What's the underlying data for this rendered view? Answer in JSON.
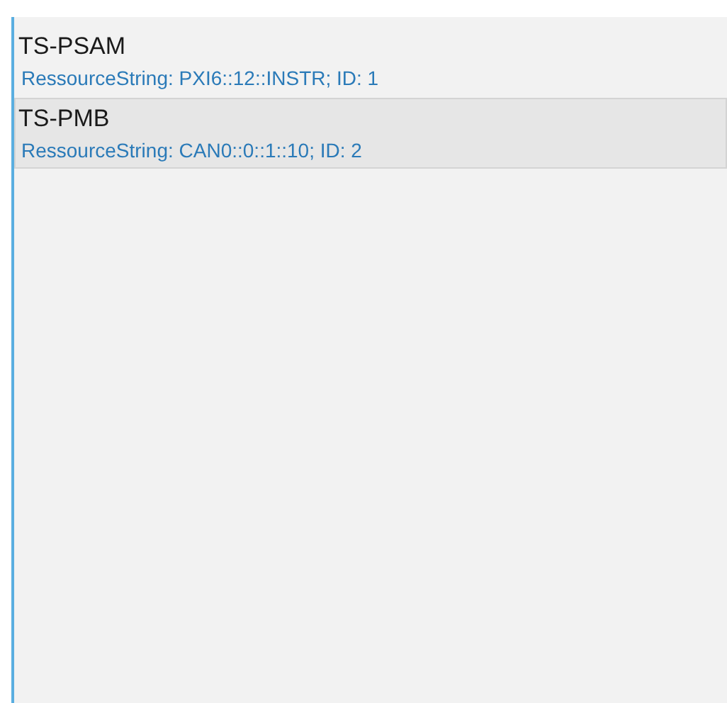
{
  "devices": [
    {
      "name": "TS-PSAM",
      "detail": "RessourceString: PXI6::12::INSTR; ID: 1",
      "selected": false
    },
    {
      "name": "TS-PMB",
      "detail": "RessourceString: CAN0::0::1::10; ID: 2",
      "selected": true
    }
  ]
}
